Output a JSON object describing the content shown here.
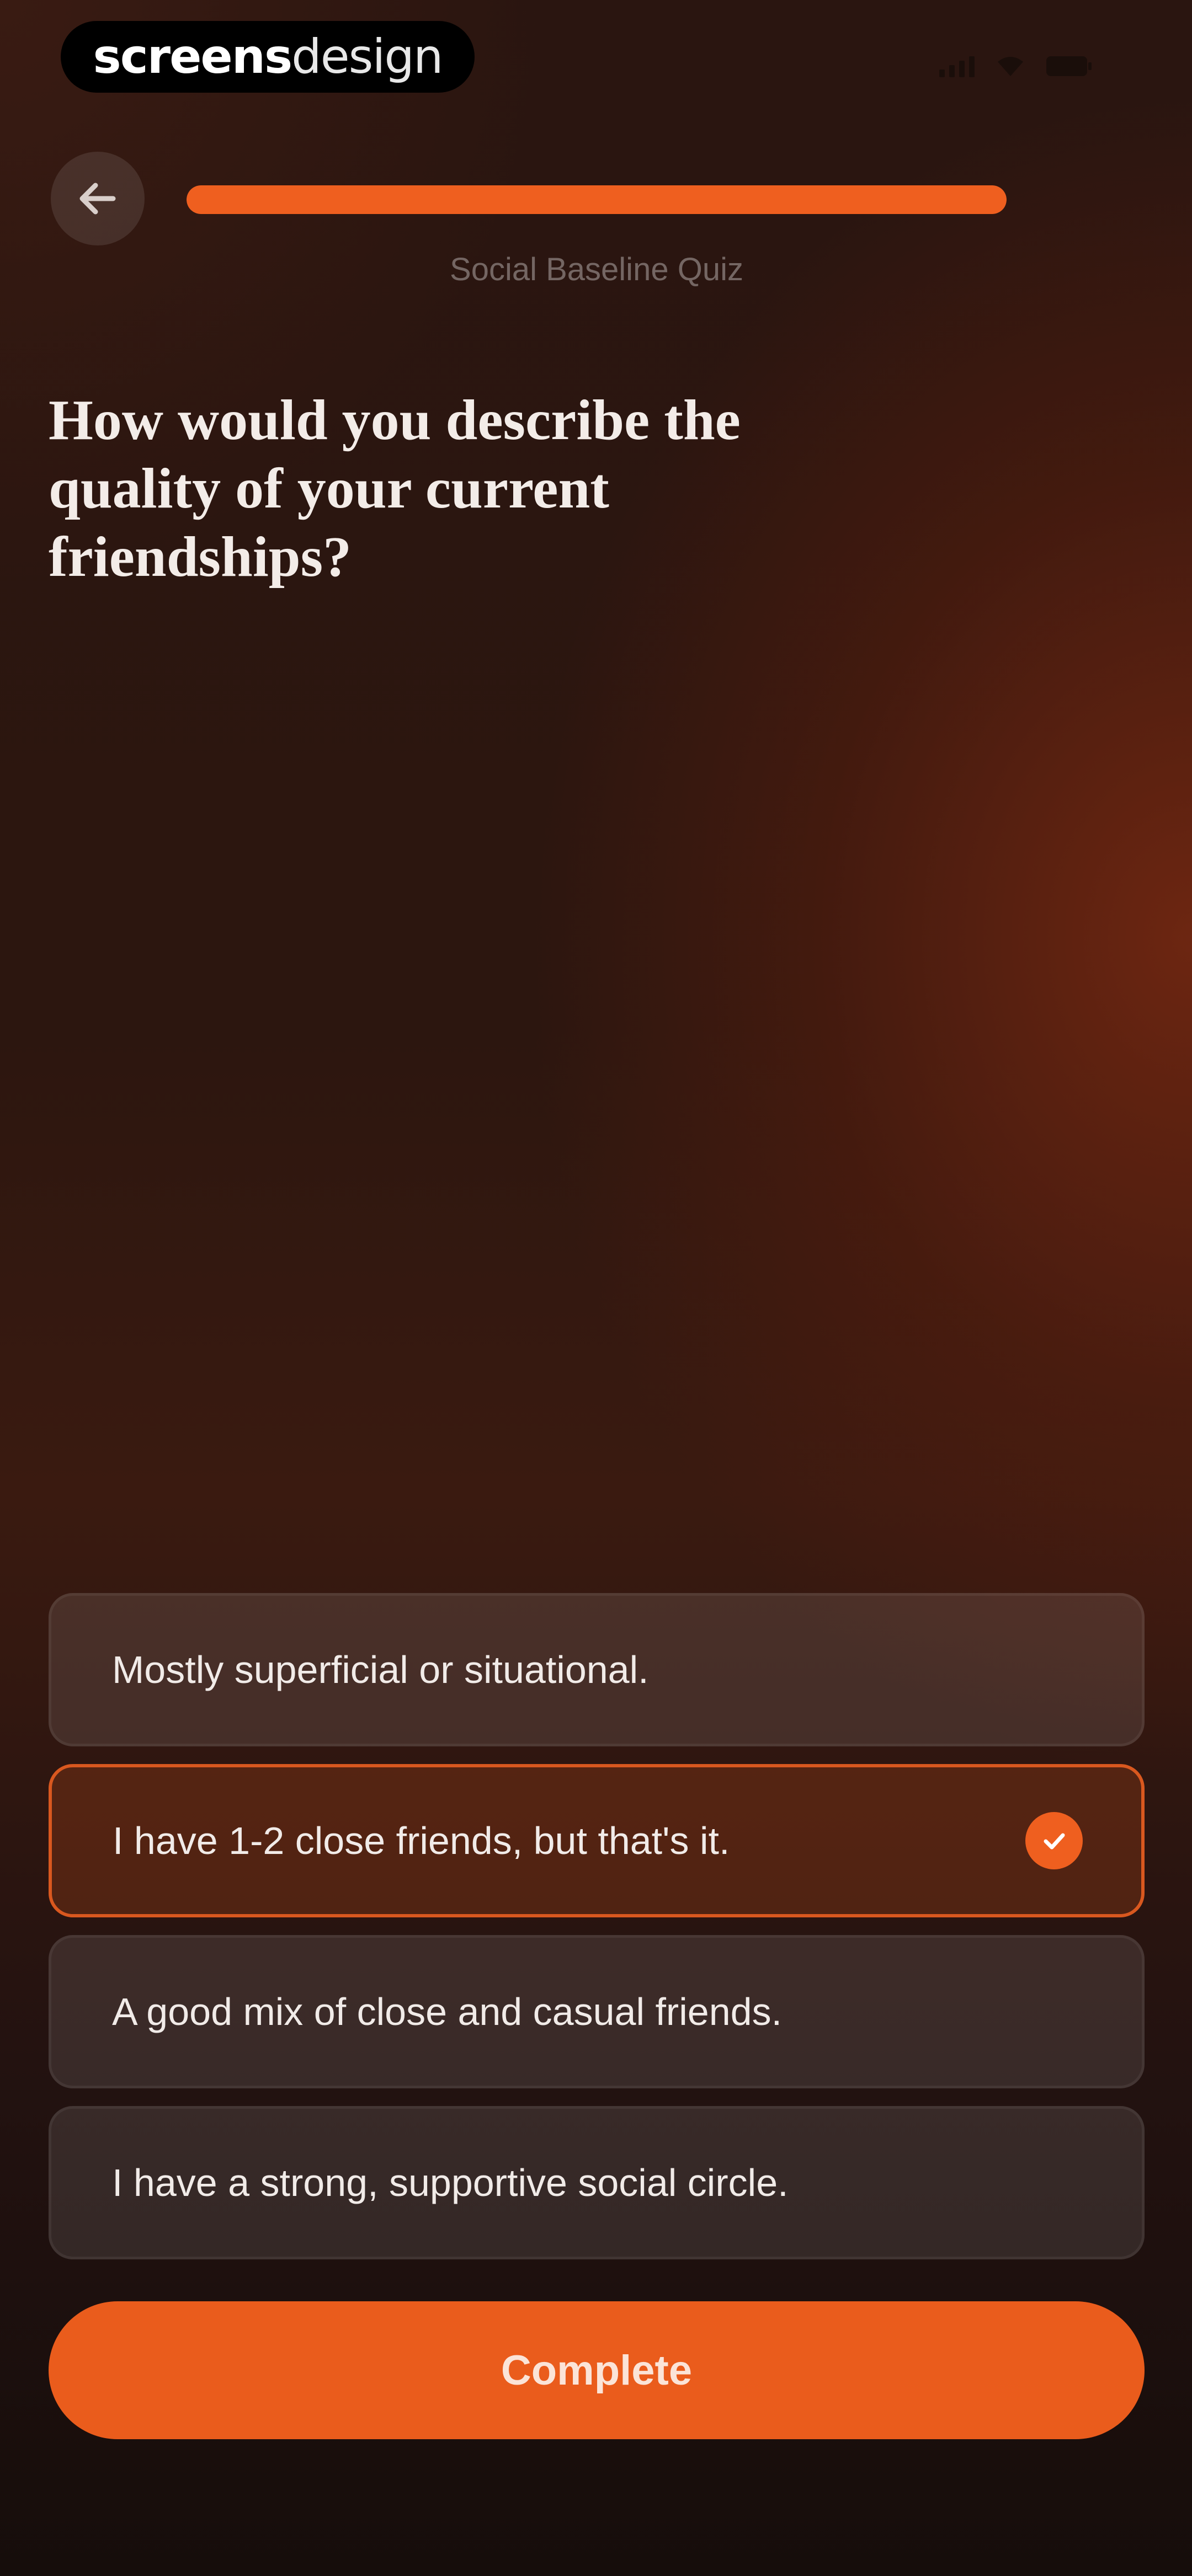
{
  "status_bar": {
    "brand_bold": "screens",
    "brand_light": "design",
    "icons": [
      "signal-icon",
      "wifi-icon",
      "battery-icon"
    ]
  },
  "header": {
    "back_icon": "arrow-left-icon",
    "progress_fraction": 1.0,
    "quiz_label": "Social Baseline Quiz"
  },
  "question": {
    "text": "How would you describe the quality of your current friendships?"
  },
  "options": [
    {
      "label": "Mostly superficial or situational.",
      "selected": false
    },
    {
      "label": "I have 1-2 close friends, but that's it.",
      "selected": true
    },
    {
      "label": "A good mix of close and casual friends.",
      "selected": false
    },
    {
      "label": "I have a strong, supportive social circle.",
      "selected": false
    }
  ],
  "complete_button": {
    "label": "Complete"
  },
  "colors": {
    "accent": "#ef5f1f",
    "background_dark": "#1c0f0c",
    "background_warm": "#5a2210"
  }
}
